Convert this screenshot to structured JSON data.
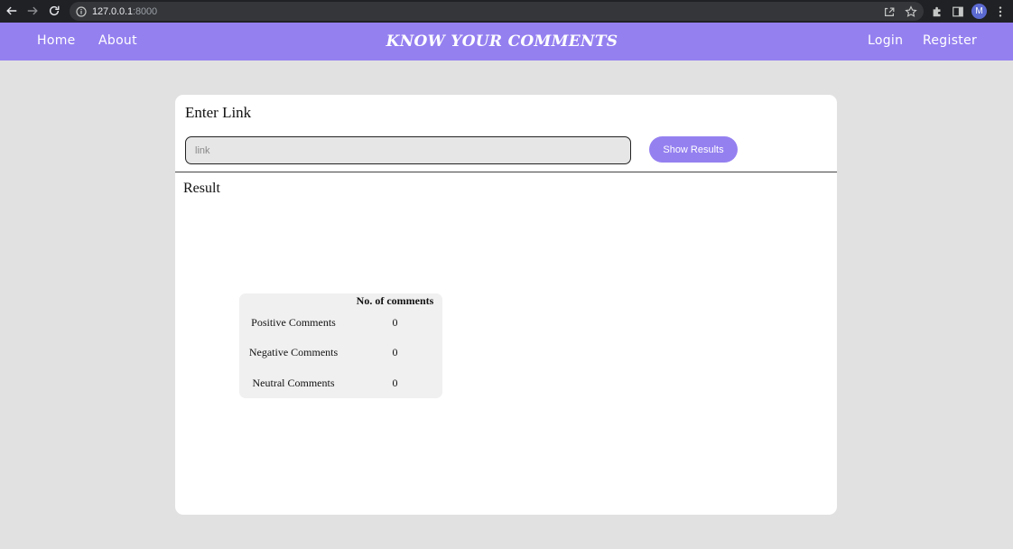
{
  "browser": {
    "url_host": "127.0.0.1",
    "url_port": ":8000",
    "profile_initial": "M"
  },
  "navbar": {
    "home": "Home",
    "about": "About",
    "brand": "KNOW YOUR COMMENTS",
    "login": "Login",
    "register": "Register"
  },
  "form": {
    "title": "Enter Link",
    "input_placeholder": "link",
    "input_value": "",
    "button_label": "Show Results"
  },
  "result": {
    "title": "Result",
    "column_header": "No. of comments",
    "rows": [
      {
        "label": "Positive Comments",
        "count": "0"
      },
      {
        "label": "Negative Comments",
        "count": "0"
      },
      {
        "label": "Neutral Comments",
        "count": "0"
      }
    ]
  },
  "colors": {
    "accent": "#9580f0",
    "page_bg": "#e1e1e1",
    "chrome_bg": "#202124"
  }
}
